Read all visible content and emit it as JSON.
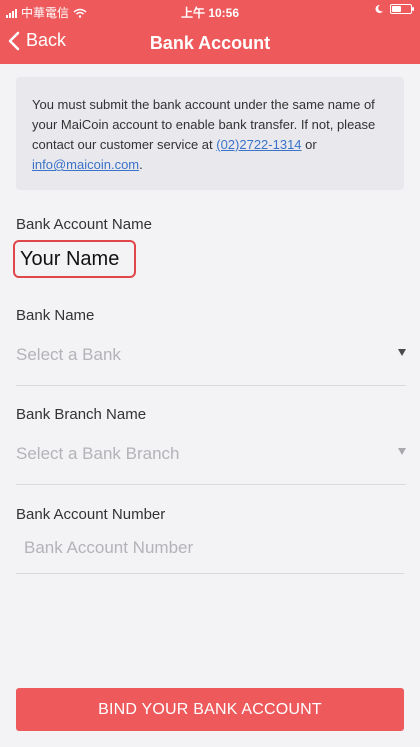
{
  "status_bar": {
    "carrier": "中華電信",
    "time": "上午 10:56"
  },
  "nav": {
    "back_label": "Back",
    "title": "Bank Account"
  },
  "notice": {
    "text_before_phone": "You must submit the bank account under the same name of your MaiCoin account to enable bank transfer. If not, please contact our customer service at ",
    "phone": "(02)2722-1314",
    "text_between": " or ",
    "email": "info@maicoin.com",
    "text_after": "."
  },
  "form": {
    "account_name_label": "Bank Account Name",
    "account_name_value": "Your Name",
    "bank_name_label": "Bank Name",
    "bank_name_placeholder": "Select a Bank",
    "branch_label": "Bank Branch Name",
    "branch_placeholder": "Select a Bank Branch",
    "account_number_label": "Bank Account Number",
    "account_number_placeholder": "Bank Account Number",
    "account_number_value": ""
  },
  "actions": {
    "bind_button": "BIND YOUR BANK ACCOUNT"
  },
  "colors": {
    "brand_red": "#ee5a5c",
    "highlight_border": "#e0474b",
    "link_blue": "#3a73c8",
    "background": "#f3f3f6"
  },
  "icons": [
    "signal-icon",
    "wifi-icon",
    "back-chevron-icon",
    "moon-icon",
    "battery-icon",
    "dropdown-caret-icon"
  ]
}
